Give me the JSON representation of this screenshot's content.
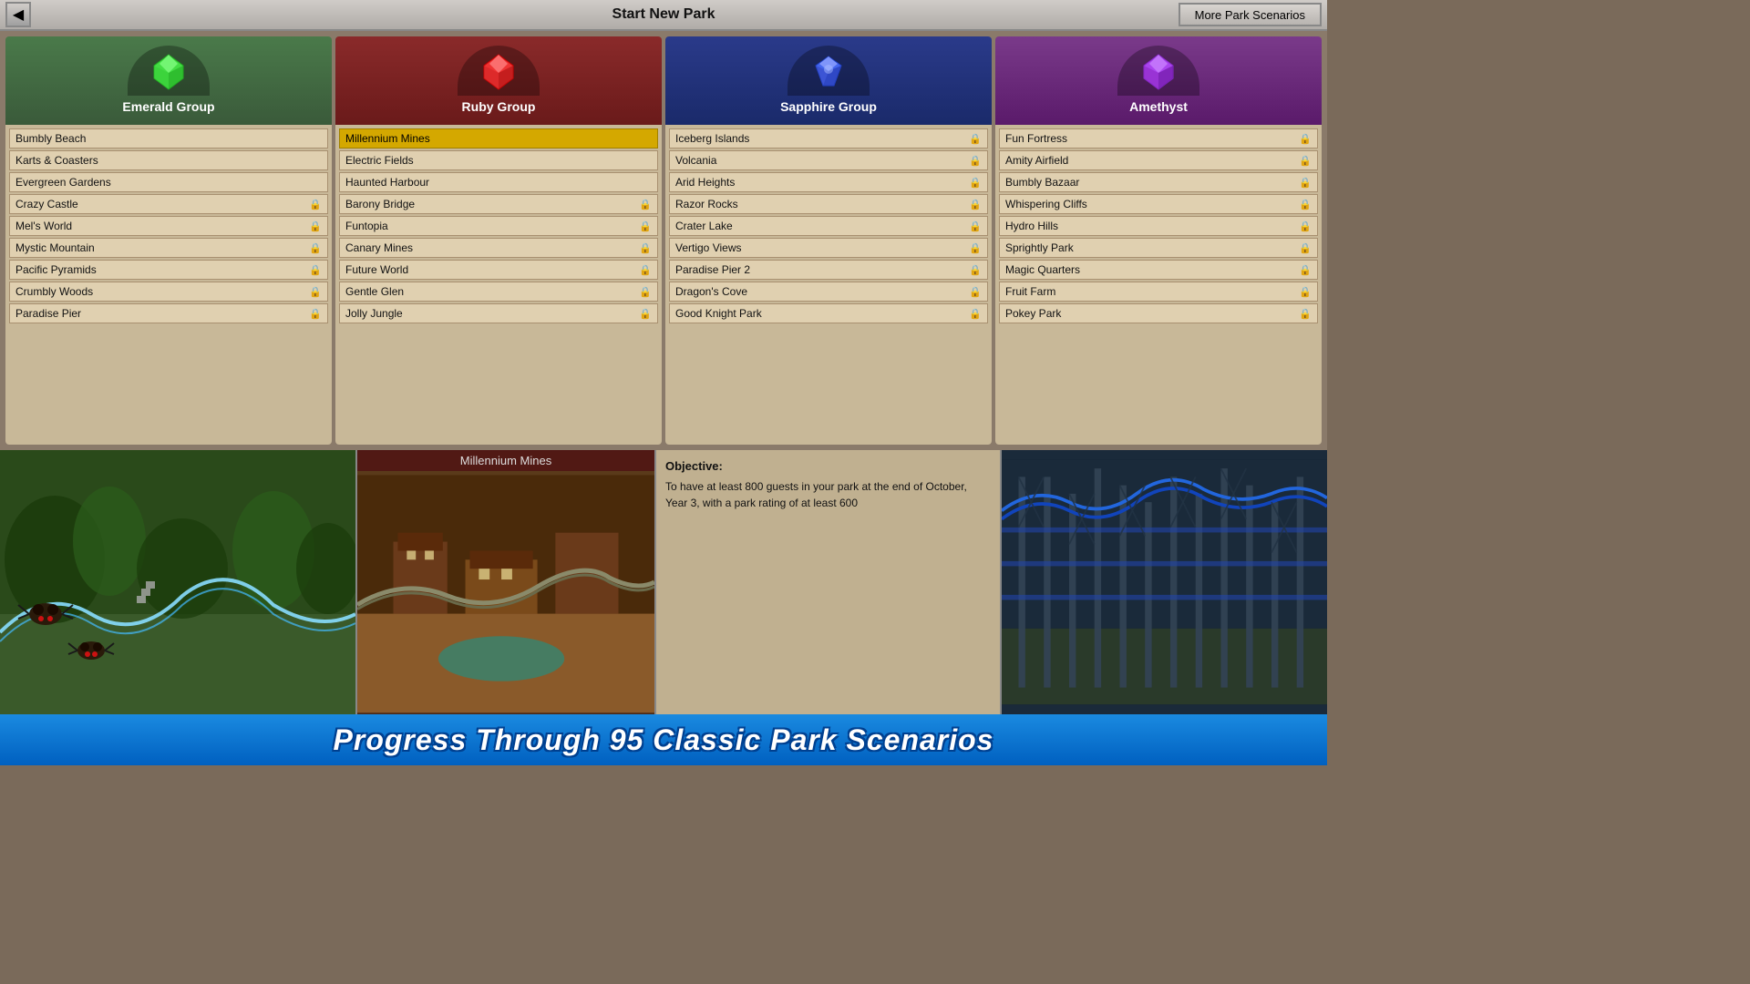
{
  "header": {
    "title": "Start New Park",
    "back_button": "◀",
    "more_button": "More Park Scenarios"
  },
  "groups": [
    {
      "id": "emerald",
      "name": "Emerald Group",
      "gem_color": "#44bb44",
      "gem_color2": "#22aa22",
      "header_class": "emerald-header",
      "parks": [
        {
          "name": "Bumbly Beach",
          "locked": false,
          "selected": false
        },
        {
          "name": "Karts & Coasters",
          "locked": false,
          "selected": false
        },
        {
          "name": "Evergreen Gardens",
          "locked": false,
          "selected": false
        },
        {
          "name": "Crazy Castle",
          "locked": true,
          "selected": false
        },
        {
          "name": "Mel's World",
          "locked": true,
          "selected": false
        },
        {
          "name": "Mystic Mountain",
          "locked": true,
          "selected": false
        },
        {
          "name": "Pacific Pyramids",
          "locked": true,
          "selected": false
        },
        {
          "name": "Crumbly Woods",
          "locked": true,
          "selected": false
        },
        {
          "name": "Paradise Pier",
          "locked": true,
          "selected": false
        }
      ]
    },
    {
      "id": "ruby",
      "name": "Ruby Group",
      "gem_color": "#ee2222",
      "gem_color2": "#cc0000",
      "header_class": "ruby-header",
      "parks": [
        {
          "name": "Millennium Mines",
          "locked": false,
          "selected": true
        },
        {
          "name": "Electric Fields",
          "locked": false,
          "selected": false
        },
        {
          "name": "Haunted Harbour",
          "locked": false,
          "selected": false
        },
        {
          "name": "Barony Bridge",
          "locked": true,
          "selected": false
        },
        {
          "name": "Funtopia",
          "locked": true,
          "selected": false
        },
        {
          "name": "Canary Mines",
          "locked": true,
          "selected": false
        },
        {
          "name": "Future World",
          "locked": true,
          "selected": false
        },
        {
          "name": "Gentle Glen",
          "locked": true,
          "selected": false
        },
        {
          "name": "Jolly Jungle",
          "locked": true,
          "selected": false
        }
      ]
    },
    {
      "id": "sapphire",
      "name": "Sapphire Group",
      "gem_color": "#2244ee",
      "gem_color2": "#0022cc",
      "header_class": "sapphire-header",
      "parks": [
        {
          "name": "Iceberg Islands",
          "locked": true,
          "selected": false
        },
        {
          "name": "Volcania",
          "locked": true,
          "selected": false
        },
        {
          "name": "Arid Heights",
          "locked": true,
          "selected": false
        },
        {
          "name": "Razor Rocks",
          "locked": true,
          "selected": false
        },
        {
          "name": "Crater Lake",
          "locked": true,
          "selected": false
        },
        {
          "name": "Vertigo Views",
          "locked": true,
          "selected": false
        },
        {
          "name": "Paradise Pier 2",
          "locked": true,
          "selected": false
        },
        {
          "name": "Dragon's Cove",
          "locked": true,
          "selected": false
        },
        {
          "name": "Good Knight Park",
          "locked": true,
          "selected": false
        }
      ]
    },
    {
      "id": "amethyst",
      "name": "Amethyst",
      "gem_color": "#aa44ee",
      "gem_color2": "#882acc",
      "header_class": "amethyst-header",
      "parks": [
        {
          "name": "Fun Fortress",
          "locked": true,
          "selected": false
        },
        {
          "name": "Amity Airfield",
          "locked": true,
          "selected": false
        },
        {
          "name": "Bumbly Bazaar",
          "locked": true,
          "selected": false
        },
        {
          "name": "Whispering Cliffs",
          "locked": true,
          "selected": false
        },
        {
          "name": "Hydro Hills",
          "locked": true,
          "selected": false
        },
        {
          "name": "Sprightly Park",
          "locked": true,
          "selected": false
        },
        {
          "name": "Magic Quarters",
          "locked": true,
          "selected": false
        },
        {
          "name": "Fruit Farm",
          "locked": true,
          "selected": false
        },
        {
          "name": "Pokey Park",
          "locked": true,
          "selected": false
        }
      ]
    }
  ],
  "bottom": {
    "preview_title": "Millennium Mines",
    "objective_label": "Objective:",
    "objective_text": "To have at least 800 guests in your park at the end of October, Year 3, with a park rating of at least 600"
  },
  "banner": {
    "text": "Progress Through 95 Classic Park Scenarios"
  }
}
